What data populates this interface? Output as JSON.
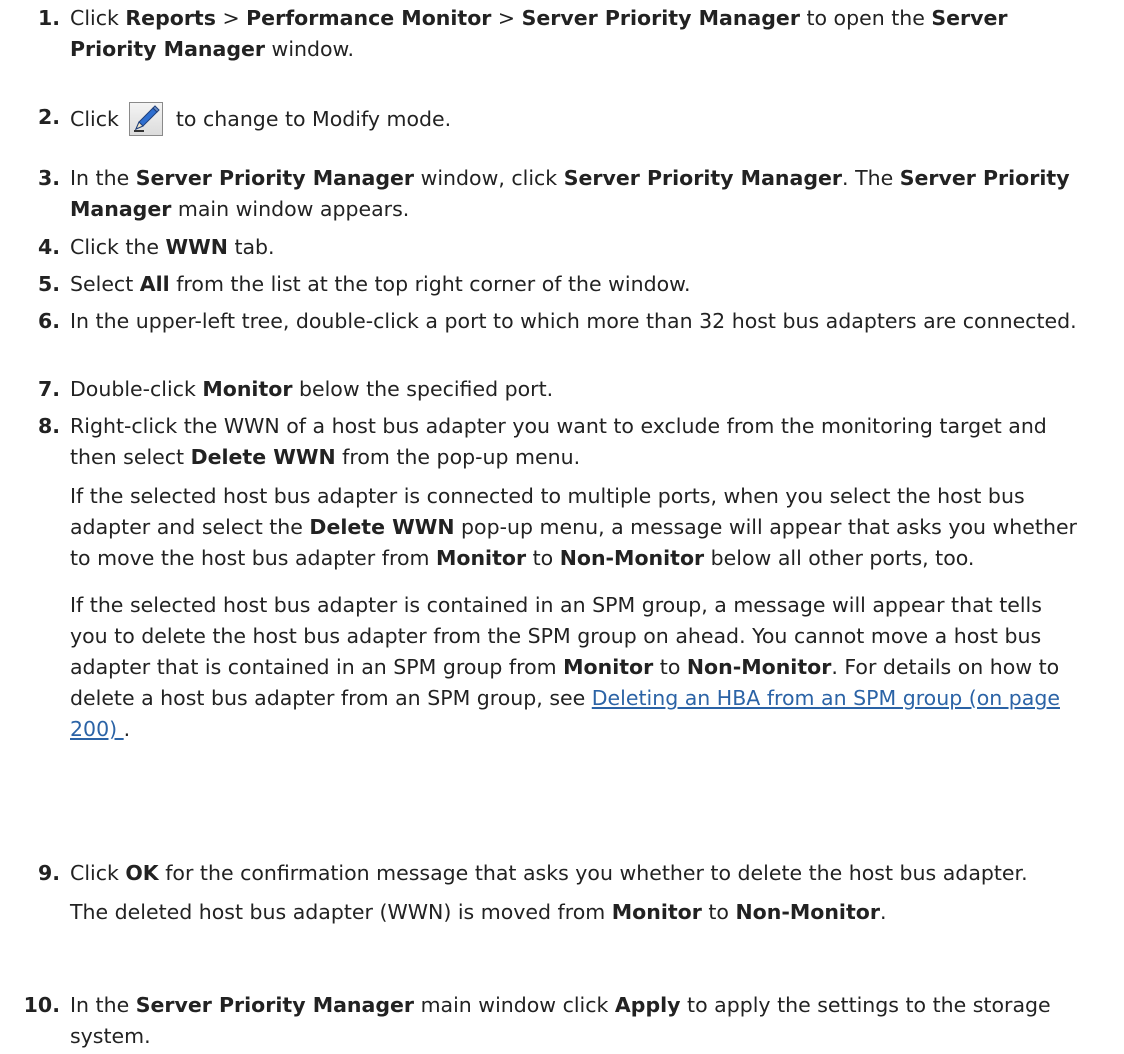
{
  "steps": [
    {
      "num": "1.",
      "paragraphs": [
        [
          {
            "t": "Click "
          },
          {
            "b": "Reports"
          },
          {
            "t": " > "
          },
          {
            "b": "Performance Monitor"
          },
          {
            "t": " > "
          },
          {
            "b": "Server Priority Manager"
          },
          {
            "t": " to open the "
          },
          {
            "b": "Server Priority Manager"
          },
          {
            "t": " window."
          }
        ]
      ]
    },
    {
      "num": "2.",
      "paragraphs": [
        [
          {
            "t": "Click "
          },
          {
            "icon": "modify-pen-icon"
          },
          {
            "t": " to change to Modify mode."
          }
        ]
      ]
    },
    {
      "num": "3.",
      "paragraphs": [
        [
          {
            "t": "In the "
          },
          {
            "b": "Server Priority Manager"
          },
          {
            "t": " window, click "
          },
          {
            "b": "Server Priority Manager"
          },
          {
            "t": ". The "
          },
          {
            "b": "Server Priority Manager"
          },
          {
            "t": " main window appears."
          }
        ]
      ]
    },
    {
      "num": "4.",
      "paragraphs": [
        [
          {
            "t": "Click the "
          },
          {
            "b": "WWN"
          },
          {
            "t": " tab."
          }
        ]
      ]
    },
    {
      "num": "5.",
      "paragraphs": [
        [
          {
            "t": "Select "
          },
          {
            "b": "All"
          },
          {
            "t": " from the list at the top right corner of the window."
          }
        ]
      ]
    },
    {
      "num": "6.",
      "paragraphs": [
        [
          {
            "t": "In the upper-left tree, double-click a port to which more than 32 host bus adapters are connected."
          }
        ]
      ]
    },
    {
      "num": "7.",
      "paragraphs": [
        [
          {
            "t": "Double-click "
          },
          {
            "b": "Monitor"
          },
          {
            "t": " below the specified port."
          }
        ]
      ]
    },
    {
      "num": "8.",
      "paragraphs": [
        [
          {
            "t": "Right-click the WWN of a host bus adapter you want to exclude from the monitoring target and then select "
          },
          {
            "b": "Delete WWN"
          },
          {
            "t": " from the pop-up menu."
          }
        ],
        [
          {
            "t": "If the selected host bus adapter is connected to multiple ports, when you select the host bus adapter and select the "
          },
          {
            "b": "Delete WWN"
          },
          {
            "t": " pop-up menu, a message will appear that asks you whether to move the host bus adapter from "
          },
          {
            "b": "Monitor"
          },
          {
            "t": " to "
          },
          {
            "b": "Non-Monitor"
          },
          {
            "t": " below all other ports, too."
          }
        ],
        [
          {
            "t": "If the selected host bus adapter is contained in an SPM group, a message will appear that tells you to delete the host bus adapter from the SPM group on ahead. You cannot move a host bus adapter that is contained in an SPM group from "
          },
          {
            "b": "Monitor"
          },
          {
            "t": " to "
          },
          {
            "b": "Non-Monitor"
          },
          {
            "t": ". For details on how to delete a host bus adapter from an SPM group, see "
          },
          {
            "link": "Deleting an HBA from an SPM group (on page 200) "
          },
          {
            "t": "."
          }
        ]
      ]
    },
    {
      "num": "9.",
      "paragraphs": [
        [
          {
            "t": "Click "
          },
          {
            "b": "OK"
          },
          {
            "t": " for the confirmation message that asks you whether to delete the host bus adapter."
          }
        ],
        [
          {
            "t": "The deleted host bus adapter (WWN) is moved from "
          },
          {
            "b": "Monitor"
          },
          {
            "t": " to "
          },
          {
            "b": "Non-Monitor"
          },
          {
            "t": "."
          }
        ]
      ]
    },
    {
      "num": "10.",
      "paragraphs": [
        [
          {
            "t": "In the "
          },
          {
            "b": "Server Priority Manager"
          },
          {
            "t": " main window click "
          },
          {
            "b": "Apply"
          },
          {
            "t": " to apply the settings to the storage system."
          }
        ]
      ]
    }
  ]
}
